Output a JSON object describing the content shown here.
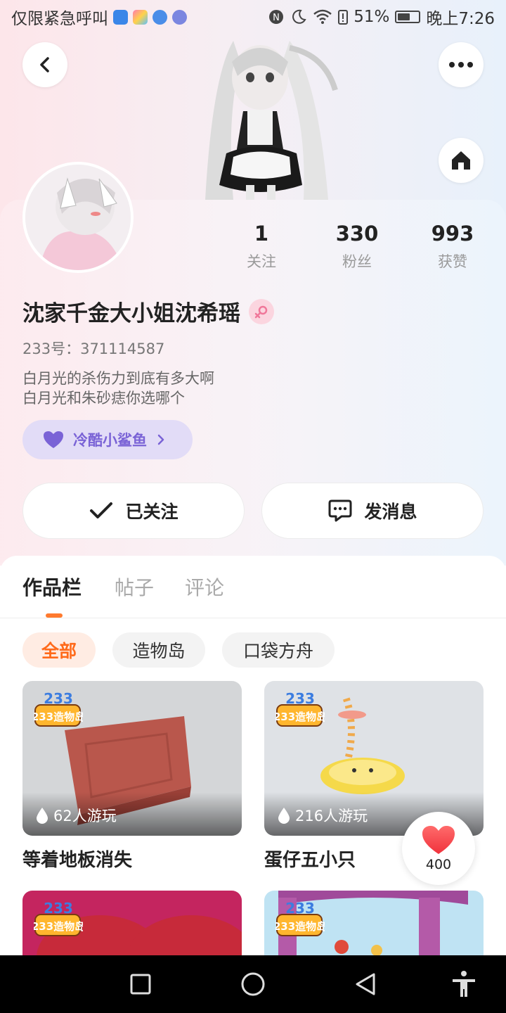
{
  "status_bar": {
    "left_text": "仅限紧急呼叫",
    "battery": "51%",
    "time": "晚上7:26",
    "app_icons": [
      "shield-app-icon",
      "store-app-icon",
      "browser-app-icon",
      "music-app-icon"
    ]
  },
  "header": {
    "back_icon": "chevron-left-icon",
    "more_icon": "more-dots-icon",
    "home_icon": "home-icon"
  },
  "profile": {
    "stats": [
      {
        "value": "1",
        "label": "关注"
      },
      {
        "value": "330",
        "label": "粉丝"
      },
      {
        "value": "993",
        "label": "获赞"
      }
    ],
    "nickname": "沈家千金大小姐沈希瑶",
    "gender_icon": "female-icon",
    "uid": "233号：371114587",
    "bio_line1": "白月光的杀伤力到底有多大啊",
    "bio_line2": "白月光和朱砂痣你选哪个",
    "fan_tag": "冷酷小鲨鱼",
    "colors": {
      "fan_tag_text": "#7a63d6",
      "accent": "#ff6a1a"
    }
  },
  "actions": {
    "follow_label": "已关注",
    "message_label": "发消息"
  },
  "tabs": [
    {
      "label": "作品栏",
      "active": true
    },
    {
      "label": "帖子",
      "active": false
    },
    {
      "label": "评论",
      "active": false
    }
  ],
  "filters": [
    {
      "label": "全部",
      "active": true
    },
    {
      "label": "造物岛",
      "active": false
    },
    {
      "label": "口袋方舟",
      "active": false
    }
  ],
  "works": [
    {
      "badge": "233造物岛",
      "plays": "62人游玩",
      "title": "等着地板消失"
    },
    {
      "badge": "233造物岛",
      "plays": "216人游玩",
      "title": "蛋仔五小只"
    },
    {
      "badge": "233造物岛"
    },
    {
      "badge": "233造物岛"
    }
  ],
  "like_fab": {
    "count": "400"
  },
  "nav_bar": [
    "recents-square-icon",
    "home-circle-icon",
    "back-triangle-icon",
    "accessibility-icon"
  ]
}
